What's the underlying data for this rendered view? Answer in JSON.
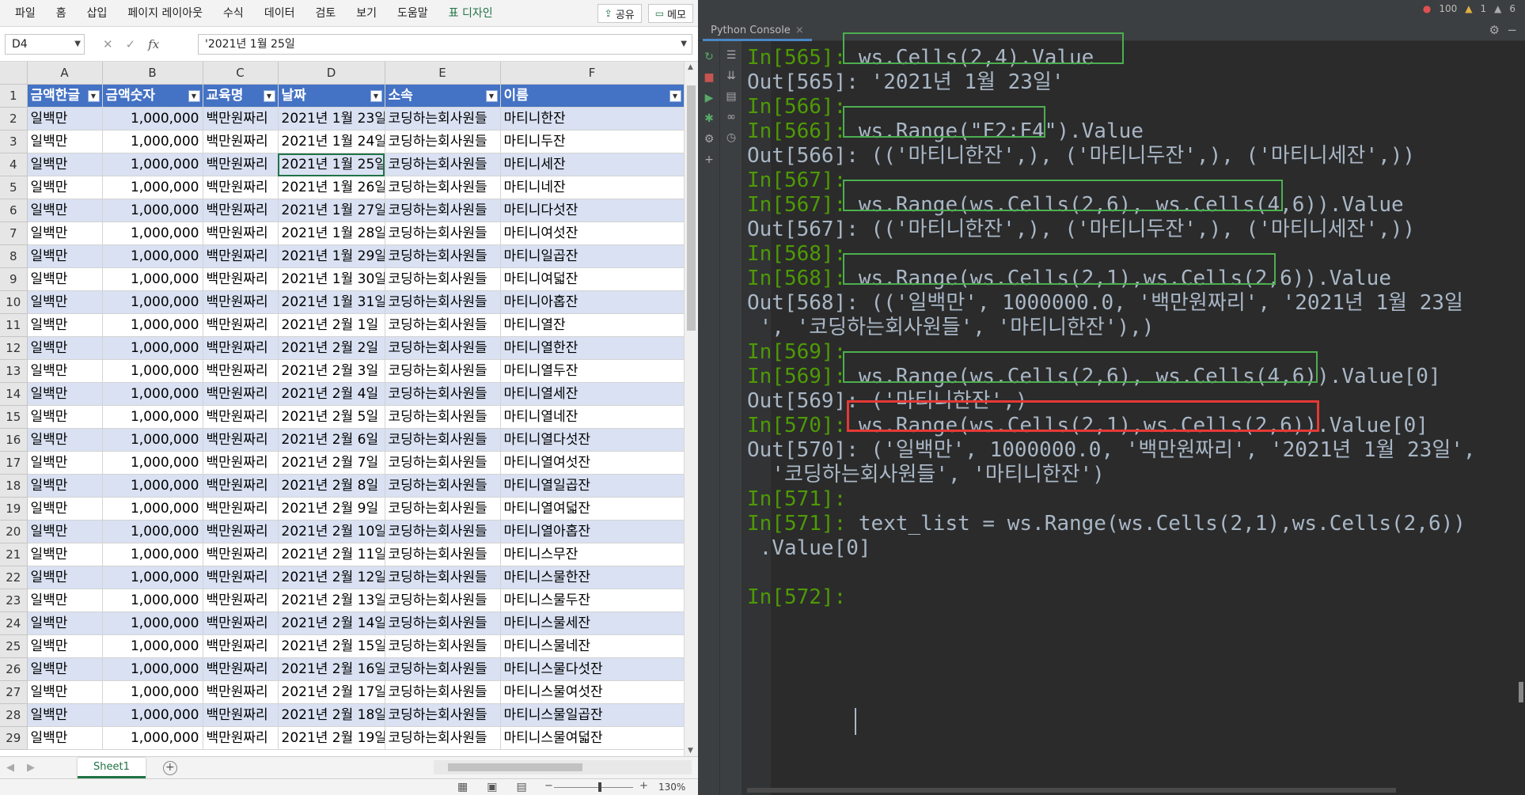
{
  "excel": {
    "ribbon_tabs": [
      "파일",
      "홈",
      "삽입",
      "페이지 레이아웃",
      "수식",
      "데이터",
      "검토",
      "보기",
      "도움말",
      "표 디자인"
    ],
    "share_label": "공유",
    "memo_label": "메모",
    "name_box": "D4",
    "formula": "'2021년 1월 25일",
    "columns": [
      "A",
      "B",
      "C",
      "D",
      "E",
      "F"
    ],
    "headers": [
      "금액한글",
      "금액숫자",
      "교육명",
      "날짜",
      "소속",
      "이름"
    ],
    "rows": [
      {
        "num": "2",
        "a": "일백만",
        "b": "1,000,000",
        "c": "백만원짜리",
        "d": "2021년 1월 23일",
        "e": "코딩하는회사원들",
        "f": "마티니한잔"
      },
      {
        "num": "3",
        "a": "일백만",
        "b": "1,000,000",
        "c": "백만원짜리",
        "d": "2021년 1월 24일",
        "e": "코딩하는회사원들",
        "f": "마티니두잔"
      },
      {
        "num": "4",
        "a": "일백만",
        "b": "1,000,000",
        "c": "백만원짜리",
        "d": "2021년 1월 25일",
        "e": "코딩하는회사원들",
        "f": "마티니세잔"
      },
      {
        "num": "5",
        "a": "일백만",
        "b": "1,000,000",
        "c": "백만원짜리",
        "d": "2021년 1월 26일",
        "e": "코딩하는회사원들",
        "f": "마티니네잔"
      },
      {
        "num": "6",
        "a": "일백만",
        "b": "1,000,000",
        "c": "백만원짜리",
        "d": "2021년 1월 27일",
        "e": "코딩하는회사원들",
        "f": "마티니다섯잔"
      },
      {
        "num": "7",
        "a": "일백만",
        "b": "1,000,000",
        "c": "백만원짜리",
        "d": "2021년 1월 28일",
        "e": "코딩하는회사원들",
        "f": "마티니여섯잔"
      },
      {
        "num": "8",
        "a": "일백만",
        "b": "1,000,000",
        "c": "백만원짜리",
        "d": "2021년 1월 29일",
        "e": "코딩하는회사원들",
        "f": "마티니일곱잔"
      },
      {
        "num": "9",
        "a": "일백만",
        "b": "1,000,000",
        "c": "백만원짜리",
        "d": "2021년 1월 30일",
        "e": "코딩하는회사원들",
        "f": "마티니여덟잔"
      },
      {
        "num": "10",
        "a": "일백만",
        "b": "1,000,000",
        "c": "백만원짜리",
        "d": "2021년 1월 31일",
        "e": "코딩하는회사원들",
        "f": "마티니아홉잔"
      },
      {
        "num": "11",
        "a": "일백만",
        "b": "1,000,000",
        "c": "백만원짜리",
        "d": "2021년 2월 1일",
        "e": "코딩하는회사원들",
        "f": "마티니열잔"
      },
      {
        "num": "12",
        "a": "일백만",
        "b": "1,000,000",
        "c": "백만원짜리",
        "d": "2021년 2월 2일",
        "e": "코딩하는회사원들",
        "f": "마티니열한잔"
      },
      {
        "num": "13",
        "a": "일백만",
        "b": "1,000,000",
        "c": "백만원짜리",
        "d": "2021년 2월 3일",
        "e": "코딩하는회사원들",
        "f": "마티니열두잔"
      },
      {
        "num": "14",
        "a": "일백만",
        "b": "1,000,000",
        "c": "백만원짜리",
        "d": "2021년 2월 4일",
        "e": "코딩하는회사원들",
        "f": "마티니열세잔"
      },
      {
        "num": "15",
        "a": "일백만",
        "b": "1,000,000",
        "c": "백만원짜리",
        "d": "2021년 2월 5일",
        "e": "코딩하는회사원들",
        "f": "마티니열네잔"
      },
      {
        "num": "16",
        "a": "일백만",
        "b": "1,000,000",
        "c": "백만원짜리",
        "d": "2021년 2월 6일",
        "e": "코딩하는회사원들",
        "f": "마티니열다섯잔"
      },
      {
        "num": "17",
        "a": "일백만",
        "b": "1,000,000",
        "c": "백만원짜리",
        "d": "2021년 2월 7일",
        "e": "코딩하는회사원들",
        "f": "마티니열여섯잔"
      },
      {
        "num": "18",
        "a": "일백만",
        "b": "1,000,000",
        "c": "백만원짜리",
        "d": "2021년 2월 8일",
        "e": "코딩하는회사원들",
        "f": "마티니열일곱잔"
      },
      {
        "num": "19",
        "a": "일백만",
        "b": "1,000,000",
        "c": "백만원짜리",
        "d": "2021년 2월 9일",
        "e": "코딩하는회사원들",
        "f": "마티니열여덟잔"
      },
      {
        "num": "20",
        "a": "일백만",
        "b": "1,000,000",
        "c": "백만원짜리",
        "d": "2021년 2월 10일",
        "e": "코딩하는회사원들",
        "f": "마티니열아홉잔"
      },
      {
        "num": "21",
        "a": "일백만",
        "b": "1,000,000",
        "c": "백만원짜리",
        "d": "2021년 2월 11일",
        "e": "코딩하는회사원들",
        "f": "마티니스무잔"
      },
      {
        "num": "22",
        "a": "일백만",
        "b": "1,000,000",
        "c": "백만원짜리",
        "d": "2021년 2월 12일",
        "e": "코딩하는회사원들",
        "f": "마티니스물한잔"
      },
      {
        "num": "23",
        "a": "일백만",
        "b": "1,000,000",
        "c": "백만원짜리",
        "d": "2021년 2월 13일",
        "e": "코딩하는회사원들",
        "f": "마티니스물두잔"
      },
      {
        "num": "24",
        "a": "일백만",
        "b": "1,000,000",
        "c": "백만원짜리",
        "d": "2021년 2월 14일",
        "e": "코딩하는회사원들",
        "f": "마티니스물세잔"
      },
      {
        "num": "25",
        "a": "일백만",
        "b": "1,000,000",
        "c": "백만원짜리",
        "d": "2021년 2월 15일",
        "e": "코딩하는회사원들",
        "f": "마티니스물네잔"
      },
      {
        "num": "26",
        "a": "일백만",
        "b": "1,000,000",
        "c": "백만원짜리",
        "d": "2021년 2월 16일",
        "e": "코딩하는회사원들",
        "f": "마티니스물다섯잔"
      },
      {
        "num": "27",
        "a": "일백만",
        "b": "1,000,000",
        "c": "백만원짜리",
        "d": "2021년 2월 17일",
        "e": "코딩하는회사원들",
        "f": "마티니스물여섯잔"
      },
      {
        "num": "28",
        "a": "일백만",
        "b": "1,000,000",
        "c": "백만원짜리",
        "d": "2021년 2월 18일",
        "e": "코딩하는회사원들",
        "f": "마티니스물일곱잔"
      },
      {
        "num": "29",
        "a": "일백만",
        "b": "1,000,000",
        "c": "백만원짜리",
        "d": "2021년 2월 19일",
        "e": "코딩하는회사원들",
        "f": "마티니스물여덟잔"
      }
    ],
    "sheet_tab": "Sheet1",
    "zoom": "130%"
  },
  "ide": {
    "badges": {
      "errors": "100",
      "warnings": "1",
      "infos": "6"
    },
    "console_tab": "Python Console",
    "lines": [
      {
        "prompt": "In[565]: ",
        "code": "ws.Cells(2,4).Value"
      },
      {
        "prompt": "Out[565]: ",
        "code": "'2021년 1월 23일'"
      },
      {
        "prompt": "In[566]: ",
        "code": ""
      },
      {
        "prompt": "In[566]: ",
        "code": "ws.Range(\"F2:F4\").Value"
      },
      {
        "prompt": "Out[566]: ",
        "code": "(('마티니한잔',), ('마티니두잔',), ('마티니세잔',))"
      },
      {
        "prompt": "In[567]: ",
        "code": ""
      },
      {
        "prompt": "In[567]: ",
        "code": "ws.Range(ws.Cells(2,6), ws.Cells(4,6)).Value"
      },
      {
        "prompt": "Out[567]: ",
        "code": "(('마티니한잔',), ('마티니두잔',), ('마티니세잔',))"
      },
      {
        "prompt": "In[568]: ",
        "code": ""
      },
      {
        "prompt": "In[568]: ",
        "code": "ws.Range(ws.Cells(2,1),ws.Cells(2,6)).Value"
      },
      {
        "prompt": "Out[568]: ",
        "code": "(('일백만', 1000000.0, '백만원짜리', '2021년 1월 23일"
      },
      {
        "prompt": "",
        "code": " ', '코딩하는회사원들', '마티니한잔'),)"
      },
      {
        "prompt": "In[569]: ",
        "code": ""
      },
      {
        "prompt": "In[569]: ",
        "code": "ws.Range(ws.Cells(2,6), ws.Cells(4,6)).Value[0]"
      },
      {
        "prompt": "Out[569]: ",
        "code": "('마티니한잔',)"
      },
      {
        "prompt": "In[570]: ",
        "code": "ws.Range(ws.Cells(2,1),ws.Cells(2,6)).Value[0]"
      },
      {
        "prompt": "Out[570]: ",
        "code": "('일백만', 1000000.0, '백만원짜리', '2021년 1월 23일',"
      },
      {
        "prompt": "",
        "code": "  '코딩하는회사원들', '마티니한잔')"
      },
      {
        "prompt": "In[571]: ",
        "code": ""
      },
      {
        "prompt": "In[571]: ",
        "code": "text_list = ws.Range(ws.Cells(2,1),ws.Cells(2,6))"
      },
      {
        "prompt": "",
        "code": " .Value[0]"
      },
      {
        "prompt": "",
        "code": ""
      },
      {
        "prompt": "In[572]: ",
        "code": ""
      }
    ]
  }
}
